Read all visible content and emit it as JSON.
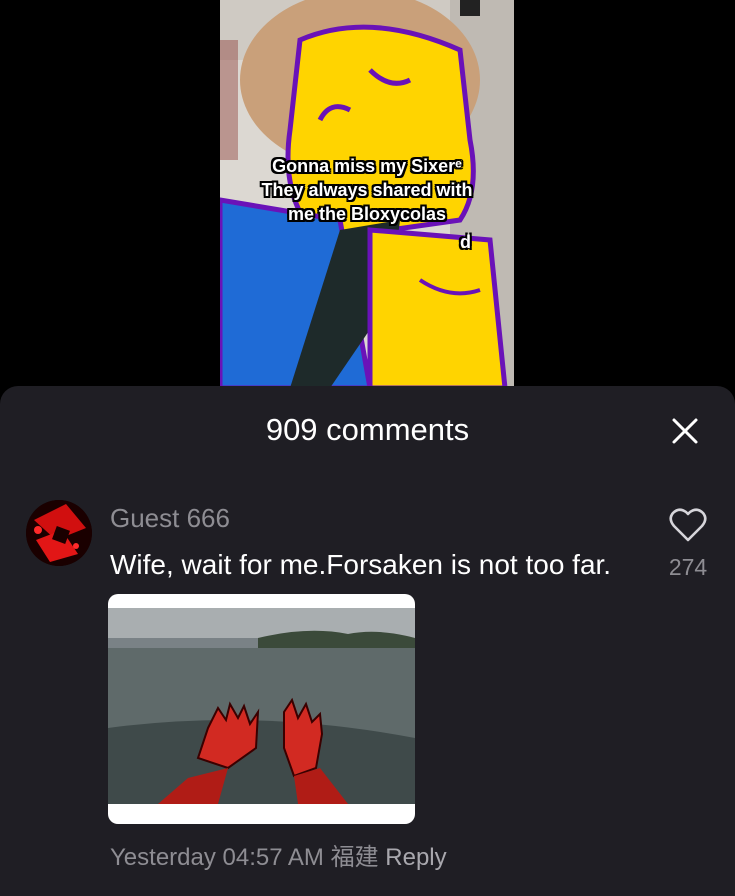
{
  "video": {
    "caption_lines": [
      "Gonna miss my Sixerᵉ",
      "They always shared with",
      "me the Bloxycolas"
    ],
    "caption_fragment": "d"
  },
  "comments_panel": {
    "title": "909 comments",
    "close_icon": "close-icon"
  },
  "comment": {
    "username": "Guest 666",
    "text": "Wife, wait for me.Forsaken is not too far.",
    "like_count": "274",
    "like_icon": "heart-outline-icon",
    "timestamp": "Yesterday 04:57 AM",
    "location": "福建",
    "reply_label": "Reply"
  },
  "colors": {
    "panel_bg": "#1f1e24",
    "muted_text": "#8e8d93",
    "character_yellow": "#ffd400",
    "character_outline": "#6a12b8",
    "character_blue": "#1f6bd6"
  }
}
